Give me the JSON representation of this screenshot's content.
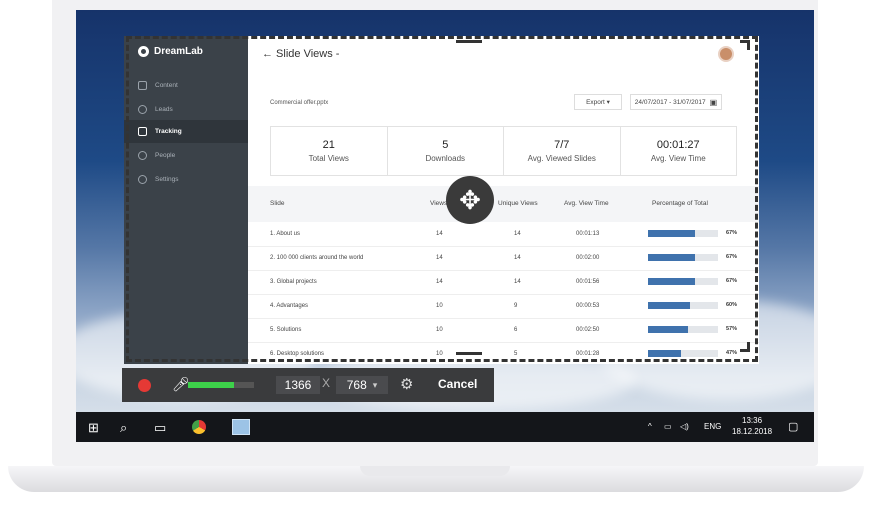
{
  "app": {
    "brand": "DreamLab",
    "nav": [
      "Content",
      "Leads",
      "Tracking",
      "People",
      "Settings"
    ],
    "active_nav": "Tracking",
    "page_title": "← Slide Views -",
    "file_name": "Commercial offer.pptx",
    "export_label": "Export ▾",
    "date_range": "24/07/2017 - 31/07/2017",
    "stats": [
      {
        "value": "21",
        "label": "Total Views"
      },
      {
        "value": "5",
        "label": "Downloads"
      },
      {
        "value": "7/7",
        "label": "Avg. Viewed Slides"
      },
      {
        "value": "00:01:27",
        "label": "Avg. View Time"
      }
    ],
    "table_headers": [
      "Slide",
      "Views",
      "Unique Views",
      "Avg. View Time",
      "Percentage of Total"
    ],
    "rows": [
      {
        "slide": "1. About us",
        "views": "14",
        "unique": "14",
        "time": "00:01:13",
        "pct": "67%",
        "pct_value": 67
      },
      {
        "slide": "2. 100 000 clients around the world",
        "views": "14",
        "unique": "14",
        "time": "00:02:00",
        "pct": "67%",
        "pct_value": 67
      },
      {
        "slide": "3. Global projects",
        "views": "14",
        "unique": "14",
        "time": "00:01:56",
        "pct": "67%",
        "pct_value": 67
      },
      {
        "slide": "4. Advantages",
        "views": "10",
        "unique": "9",
        "time": "00:00:53",
        "pct": "60%",
        "pct_value": 60
      },
      {
        "slide": "5. Solutions",
        "views": "10",
        "unique": "6",
        "time": "00:02:50",
        "pct": "57%",
        "pct_value": 57
      },
      {
        "slide": "6. Desktop solutions",
        "views": "10",
        "unique": "5",
        "time": "00:01:28",
        "pct": "47%",
        "pct_value": 47
      }
    ]
  },
  "recorder": {
    "width": "1366",
    "times": "X",
    "height": "768",
    "dropdown": "▾",
    "cancel": "Cancel",
    "mic_level": 0.7
  },
  "taskbar": {
    "language": "ENG",
    "time": "13:36",
    "date": "18.12.2018"
  },
  "colors": {
    "accent": "#3f72ad",
    "record": "#e53935",
    "level": "#3dd14a"
  }
}
